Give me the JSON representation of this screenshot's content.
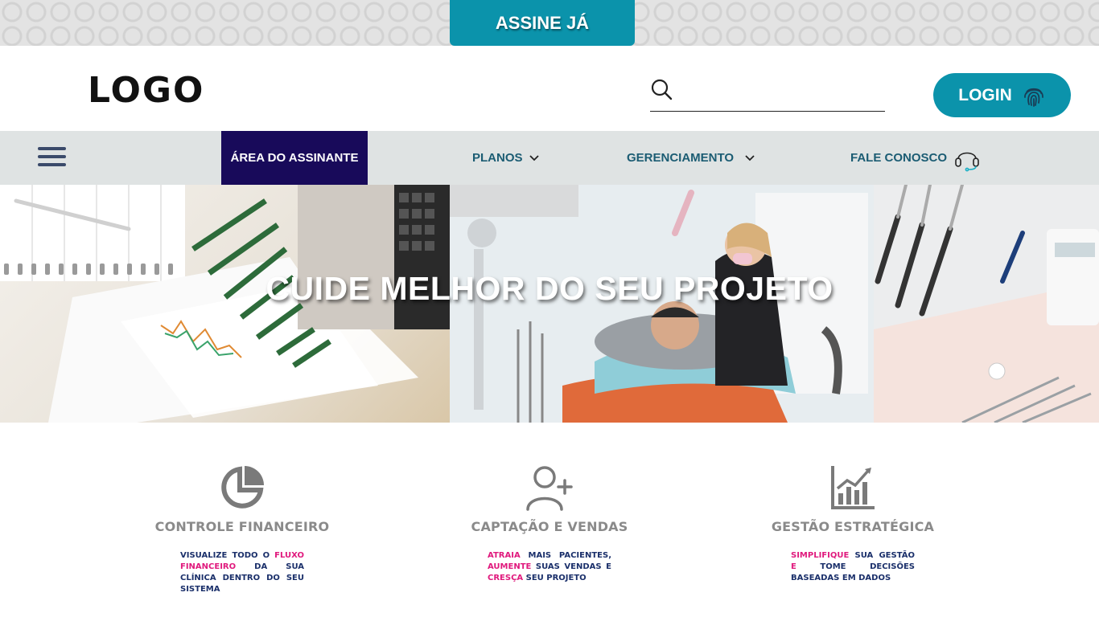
{
  "top_bar": {
    "subscribe_label": "ASSINE JÁ"
  },
  "header": {
    "logo": "LOGO",
    "search": {
      "value": "",
      "placeholder": ""
    },
    "login_label": "LOGIN"
  },
  "nav": {
    "subscriber_area": "ÁREA DO ASSINANTE",
    "plans": "PLANOS",
    "management": "GERENCIAMENTO",
    "contact": "FALE CONOSCO"
  },
  "hero": {
    "title": "CUIDE MELHOR DO SEU PROJETO"
  },
  "features": [
    {
      "title": "CONTROLE FINANCEIRO",
      "desc_parts": [
        {
          "text": "VISUALIZE TODO O ",
          "hl": false
        },
        {
          "text": "FLUXO FINANCEIRO",
          "hl": true
        },
        {
          "text": " DA SUA CLÍNICA DENTRO DO SEU SISTEMA",
          "hl": false
        }
      ]
    },
    {
      "title": "CAPTAÇÃO E VENDAS",
      "desc_parts": [
        {
          "text": "ATRAIA",
          "hl": true
        },
        {
          "text": " MAIS PACIENTES, ",
          "hl": false
        },
        {
          "text": "AUMENTE",
          "hl": true
        },
        {
          "text": " SUAS VENDAS E ",
          "hl": false
        },
        {
          "text": "CRESÇA",
          "hl": true
        },
        {
          "text": " SEU PROJETO",
          "hl": false
        }
      ]
    },
    {
      "title": "GESTÃO ESTRATÉGICA",
      "desc_parts": [
        {
          "text": "SIMPLIFIQUE",
          "hl": true
        },
        {
          "text": " SUA GESTÃO ",
          "hl": false
        },
        {
          "text": "E",
          "hl": true
        },
        {
          "text": " TOME DECISÕES BASEADAS EM DADOS",
          "hl": false
        }
      ]
    }
  ],
  "colors": {
    "accent": "#0b93ab",
    "nav_active": "#180a5a",
    "nav_text": "#1b5c73",
    "highlight": "#e0197d",
    "desc_text": "#1a2f6a"
  }
}
